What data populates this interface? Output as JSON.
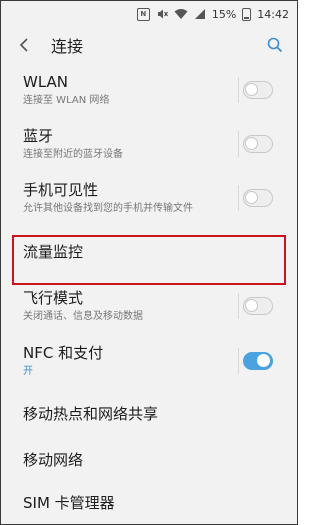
{
  "status_bar": {
    "nfc_icon_label": "N",
    "battery_percent": "15%",
    "time": "14:42"
  },
  "header": {
    "title": "连接"
  },
  "settings": [
    {
      "label": "WLAN",
      "subtitle": "连接至 WLAN 网络",
      "toggle": true,
      "enabled": false
    },
    {
      "label": "蓝牙",
      "subtitle": "连接至附近的蓝牙设备",
      "toggle": true,
      "enabled": false
    },
    {
      "label": "手机可见性",
      "subtitle": "允许其他设备找到您的手机并传输文件",
      "toggle": true,
      "enabled": false
    },
    {
      "label": "流量监控",
      "subtitle": "",
      "toggle": false,
      "highlighted": true
    },
    {
      "label": "飞行模式",
      "subtitle": "关闭通话、信息及移动数据",
      "toggle": true,
      "enabled": false
    },
    {
      "label": "NFC 和支付",
      "subtitle": "开",
      "toggle": true,
      "enabled": true
    },
    {
      "label": "移动热点和网络共享",
      "subtitle": "",
      "toggle": false
    },
    {
      "label": "移动网络",
      "subtitle": "",
      "toggle": false
    },
    {
      "label": "SIM 卡管理器",
      "subtitle": "",
      "toggle": false
    }
  ],
  "colors": {
    "highlight_border": "#c8141c",
    "toggle_on": "#4aa3e0",
    "accent_text": "#3b8fd4"
  }
}
